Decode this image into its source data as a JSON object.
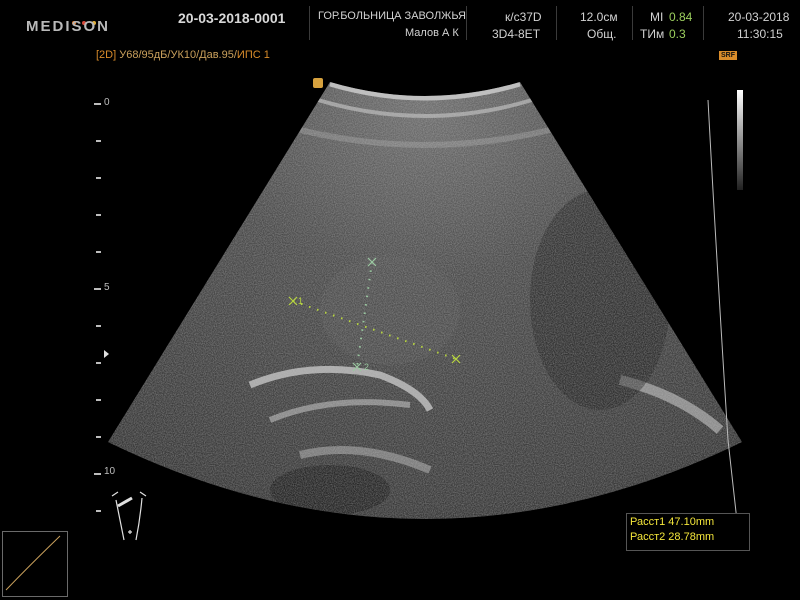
{
  "header": {
    "brand": "MEDISON",
    "patient_id": "20-03-2018-0001",
    "hospital": "ГОР.БОЛЬНИЦА ЗАВОЛЖЬЯ",
    "operator": "Малов А К",
    "preset": "к/с37D",
    "probe": "3D4-8ET",
    "depth": "12.0см",
    "app": "Общ.",
    "mi_label": "MI",
    "mi_value": "0.84",
    "tim_label": "ТИм",
    "tim_value": "0.3",
    "date": "20-03-2018",
    "time": "11:30:15"
  },
  "imaging": {
    "mode_tag": "[2D]",
    "params": "У68/95дБ/УК10/Дав.95/",
    "ips": "ИПС 1",
    "srf_label": "SRF"
  },
  "scale": {
    "labels": [
      "0",
      "5",
      "10"
    ]
  },
  "calipers": {
    "marker1": "1",
    "marker2": "2"
  },
  "measurements": {
    "line1": "Расст1 47.10mm",
    "line2": "Расст2 28.78mm"
  },
  "colors": {
    "accent_orange": "#d98c2a",
    "caliper_green": "#b8d640",
    "measure_yellow": "#f4e63a"
  }
}
